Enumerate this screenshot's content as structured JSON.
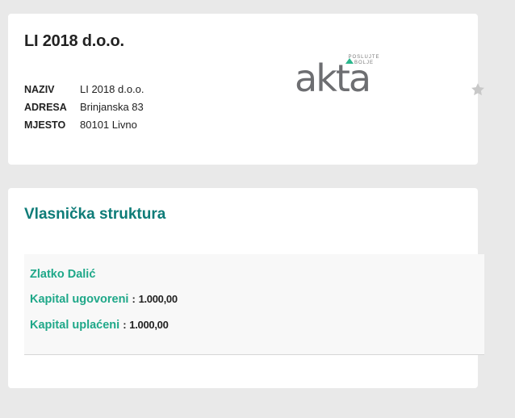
{
  "company": {
    "title": "LI 2018 d.o.o.",
    "fields": [
      {
        "label": "NAZIV",
        "value": "LI 2018 d.o.o."
      },
      {
        "label": "ADRESA",
        "value": "Brinjanska 83"
      },
      {
        "label": "MJESTO",
        "value": "80101 Livno"
      }
    ],
    "logo": {
      "word": "akta",
      "tagline_1": "POSLUJTE",
      "tagline_2": "BOLJE"
    },
    "favorite_icon": "star-icon"
  },
  "ownership": {
    "title": "Vlasnička struktura",
    "owners": [
      {
        "name": "Zlatko Dalić",
        "contracted_label": "Kapital ugovoreni",
        "contracted_value": "1.000,00",
        "paid_label": "Kapital uplaćeni",
        "paid_value": "1.000,00",
        "separator": ":"
      }
    ]
  },
  "colors": {
    "background": "#e9e9e9",
    "card": "#ffffff",
    "section_title": "#0e7c78",
    "owner_accent": "#1fa889",
    "star": "#c8c8c8",
    "logo_accent": "#2bb78d"
  }
}
